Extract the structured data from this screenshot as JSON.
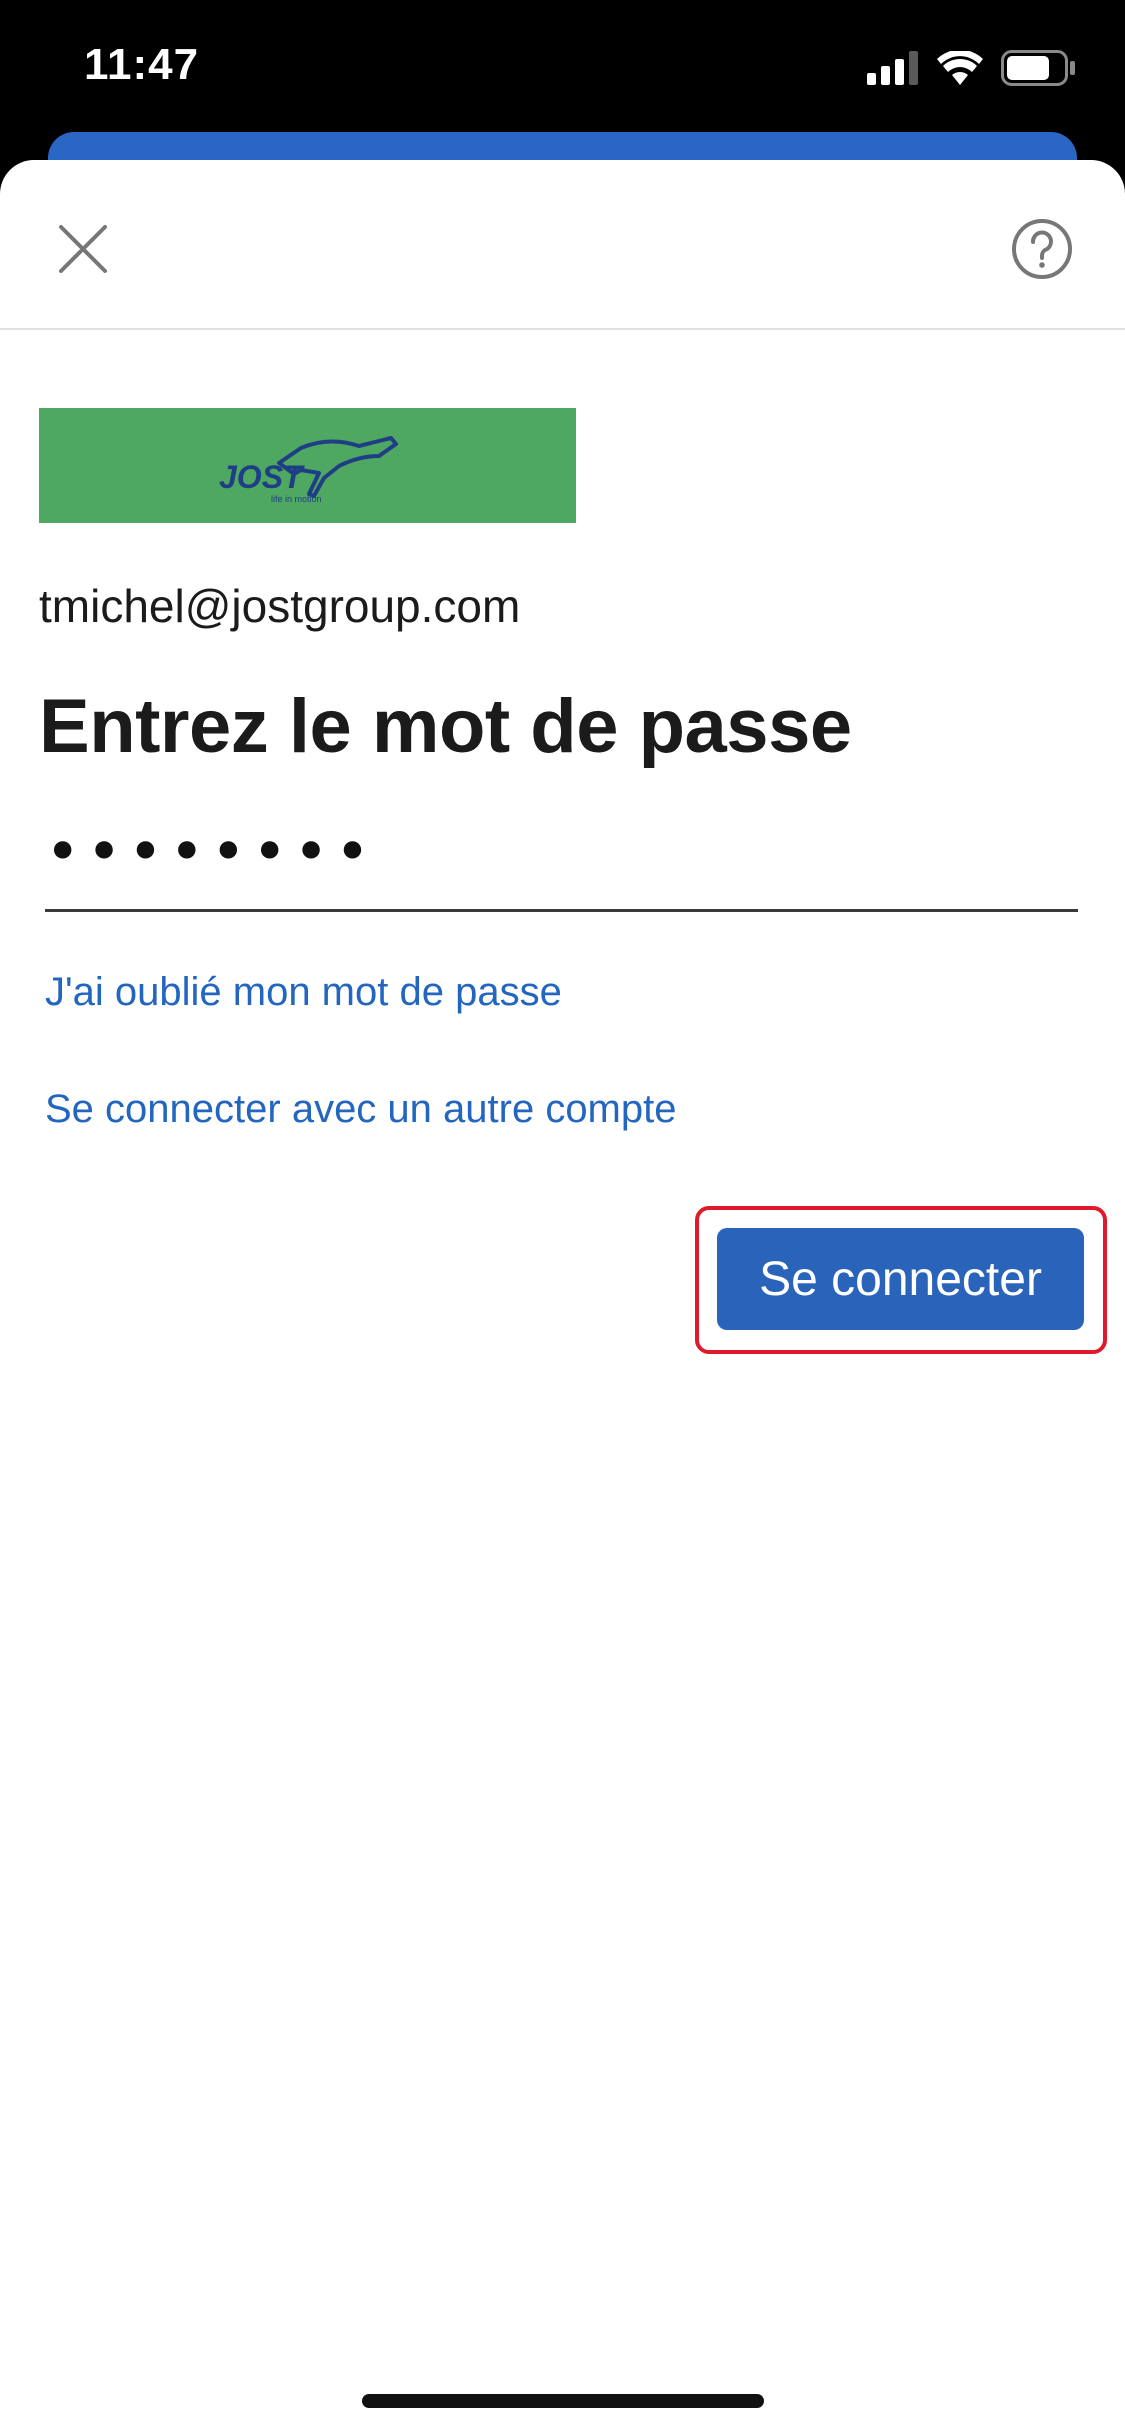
{
  "status_bar": {
    "time": "11:47",
    "signal_icon": "cellular-signal-icon",
    "wifi_icon": "wifi-icon",
    "battery_icon": "battery-icon"
  },
  "header": {
    "close_icon": "close-icon",
    "help_icon": "help-circle-icon"
  },
  "logo": {
    "brand_text": "JOST",
    "tagline": "life in motion",
    "background_color": "#4ea861"
  },
  "account": {
    "email": "tmichel@jostgroup.com"
  },
  "form": {
    "heading": "Entrez le mot de passe",
    "password_value": "••••••••",
    "forgot_password_link": "J'ai oublié mon mot de passe",
    "other_account_link": "Se connecter avec un autre compte",
    "signin_button": "Se connecter"
  },
  "colors": {
    "accent": "#2a63ba",
    "link": "#2366bf",
    "highlight": "#e0192b"
  }
}
